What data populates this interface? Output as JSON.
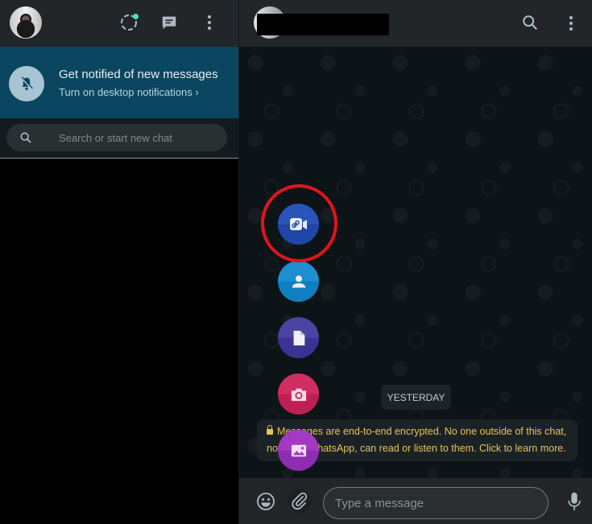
{
  "sidebar": {
    "header": {
      "icons": [
        "avatar",
        "status-icon",
        "new-chat-icon",
        "menu-icon"
      ]
    },
    "notification_banner": {
      "icon": "bell-off-icon",
      "title": "Get notified of new messages",
      "subtitle": "Turn on desktop notifications ›"
    },
    "search": {
      "placeholder": "Search or start new chat",
      "value": ""
    }
  },
  "chat": {
    "header": {
      "contact_name": "",
      "icons": [
        "search-icon",
        "menu-icon"
      ]
    },
    "attach_menu": [
      {
        "name": "video-call-link",
        "icon": "video-link-icon",
        "color": "#2b54b8",
        "highlighted": true
      },
      {
        "name": "contact",
        "icon": "person-icon",
        "color": "#1b8fd0",
        "highlighted": false
      },
      {
        "name": "document",
        "icon": "document-icon",
        "color": "#4a45a2",
        "highlighted": false
      },
      {
        "name": "camera",
        "icon": "camera-icon",
        "color": "#d02e62",
        "highlighted": false
      },
      {
        "name": "photos-videos",
        "icon": "image-icon",
        "color": "#a23ac2",
        "highlighted": false
      }
    ],
    "date_divider": "YESTERDAY",
    "encryption_notice": "Messages are end-to-end encrypted. No one outside of this chat, not even WhatsApp, can read or listen to them. Click to learn more.",
    "composer": {
      "placeholder": "Type a message",
      "value": ""
    }
  },
  "colors": {
    "banner": "#0b4660",
    "highlight_ring": "#e0141e",
    "notice_text": "#e8c25a",
    "status_dot": "#47e0c8"
  }
}
